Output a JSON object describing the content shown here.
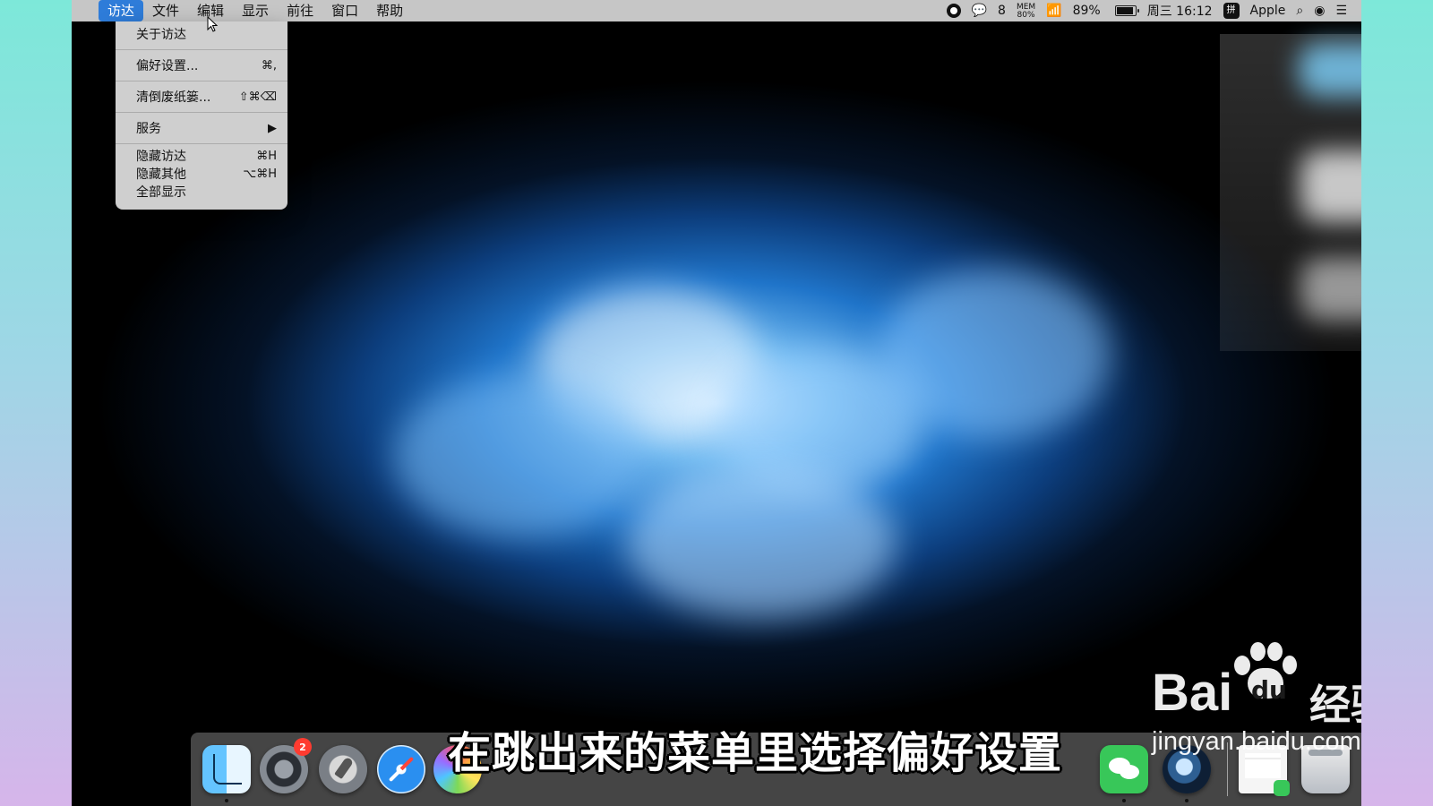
{
  "menubar": {
    "apple": "",
    "items": [
      {
        "label": "访达",
        "active": true
      },
      {
        "label": "文件"
      },
      {
        "label": "编辑"
      },
      {
        "label": "显示"
      },
      {
        "label": "前往"
      },
      {
        "label": "窗口"
      },
      {
        "label": "帮助"
      }
    ],
    "status": {
      "wechat_count": "8",
      "mem_label": "MEM",
      "mem_value": "80%",
      "wifi_icon": "wifi-icon",
      "battery_percent": "89%",
      "battery_level": 0.89,
      "datetime": "周三 16:12",
      "input_method": "拼",
      "user": "Apple"
    }
  },
  "finder_menu": {
    "items": [
      {
        "label": "关于访达",
        "shortcut": ""
      },
      {
        "label": "偏好设置...",
        "shortcut": "⌘,"
      },
      {
        "label": "清倒废纸篓...",
        "shortcut": "⇧⌘⌫"
      },
      {
        "label": "服务",
        "shortcut": "▶"
      },
      {
        "label": "隐藏访达",
        "shortcut": "⌘H"
      },
      {
        "label": "隐藏其他",
        "shortcut": "⌥⌘H"
      },
      {
        "label": "全部显示",
        "shortcut": ""
      }
    ]
  },
  "watermark": {
    "brand_left": "Bai",
    "brand_mid": "du",
    "brand_cn": "经验",
    "site": "jingyan.baidu.com"
  },
  "dock": {
    "settings_badge": "2"
  },
  "subtitle": "在跳出来的菜单里选择偏好设置"
}
